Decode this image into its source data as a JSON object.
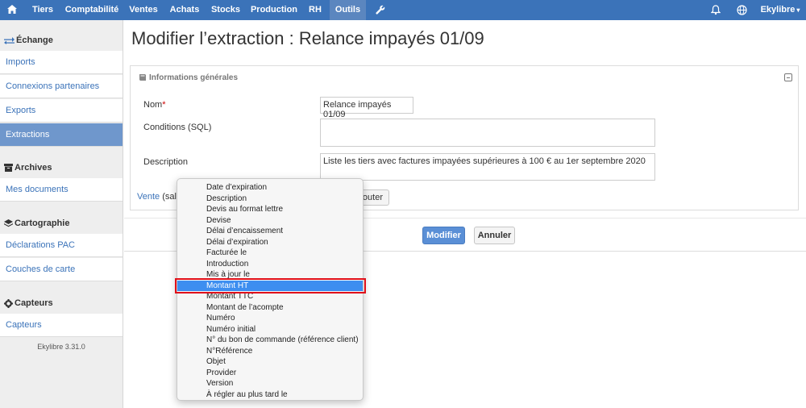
{
  "nav": {
    "home_icon": "home-icon",
    "items": [
      "Tiers",
      "Comptabilité",
      "Ventes",
      "Achats",
      "Stocks",
      "Production",
      "RH",
      "Outils"
    ],
    "active": "Outils",
    "tools_icon": "wrench-icon",
    "bell_icon": "bell-icon",
    "globe_icon": "globe-icon",
    "user_menu": "Ekylibre"
  },
  "sidebar": {
    "sections": [
      {
        "title": "Échange",
        "icon": "exchange-icon",
        "links": [
          "Imports",
          "Connexions partenaires",
          "Exports",
          "Extractions"
        ]
      },
      {
        "title": "Archives",
        "icon": "archive-icon",
        "links": [
          "Mes documents"
        ]
      },
      {
        "title": "Cartographie",
        "icon": "map-icon",
        "links": [
          "Déclarations PAC",
          "Couches de carte"
        ]
      },
      {
        "title": "Capteurs",
        "icon": "gear-icon",
        "links": [
          "Capteurs"
        ]
      }
    ],
    "active_link": "Extractions",
    "version": "Ekylibre 3.31.0"
  },
  "page": {
    "title": "Modifier l’extraction : Relance impayés 01/09"
  },
  "form": {
    "panel_title": "Informations générales",
    "name_label": "Nom",
    "required_mark": "*",
    "name_value": "Relance impayés 01/09",
    "conditions_label": "Conditions (SQL)",
    "conditions_value": "",
    "description_label": "Description",
    "description_value": "Liste les tiers avec factures impayées supérieures à 100 € au 1er septembre 2020",
    "model_link": "Vente",
    "model_suffix": "(sale)",
    "add_button": "Ajouter",
    "add_button_visible": "outer"
  },
  "actions": {
    "submit": "Modifier",
    "cancel": "Annuler"
  },
  "dropdown": {
    "options": [
      "Date d’expiration",
      "Description",
      "Devis au format lettre",
      "Devise",
      "Délai d’encaissement",
      "Délai d’expiration",
      "Facturée le",
      "Introduction",
      "Mis à jour le",
      "Montant HT",
      "Montant TTC",
      "Montant de l’acompte",
      "Numéro",
      "Numéro initial",
      "N° du bon de commande (référence client)",
      "N°Référence",
      "Objet",
      "Provider",
      "Version",
      "À régler au plus tard le"
    ],
    "selected": "Montant HT",
    "selected_color": "#3d8ef0",
    "highlight_color": "#e0101a"
  },
  "colors": {
    "nav_bg": "#3b73b9",
    "active_sidebar": "#6f97cc",
    "primary_button": "#5a8fd6"
  }
}
